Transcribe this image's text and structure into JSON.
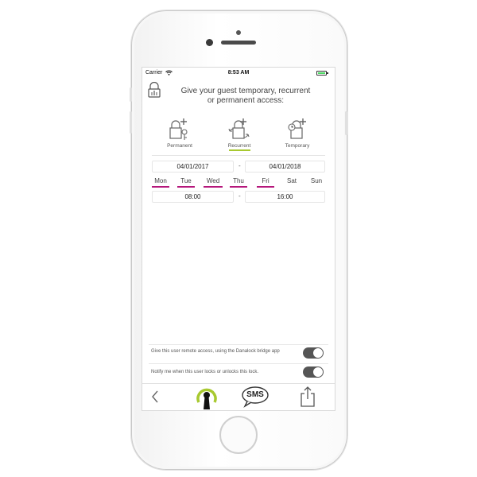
{
  "status_bar": {
    "carrier": "Carrier",
    "time": "8:53 AM"
  },
  "heading": {
    "line1": "Give your guest temporary, recurrent",
    "line2": "or permanent access:"
  },
  "access_types": [
    {
      "label": "Permanent",
      "selected": false
    },
    {
      "label": "Recurrent",
      "selected": true
    },
    {
      "label": "Temporary",
      "selected": false
    }
  ],
  "date_range": {
    "start": "04/01/2017",
    "separator": "-",
    "end": "04/01/2018"
  },
  "days": [
    {
      "label": "Mon",
      "active": true
    },
    {
      "label": "Tue",
      "active": true
    },
    {
      "label": "Wed",
      "active": true
    },
    {
      "label": "Thu",
      "active": true
    },
    {
      "label": "Fri",
      "active": true
    },
    {
      "label": "Sat",
      "active": false
    },
    {
      "label": "Sun",
      "active": false
    }
  ],
  "time_range": {
    "start": "08:00",
    "separator": "-",
    "end": "16:00"
  },
  "options": [
    {
      "text": "Give this user remote access, using the Danalock bridge app",
      "enabled": true
    },
    {
      "text": "Notify me when this user locks or unlocks this lock.",
      "enabled": true
    }
  ],
  "tabbar": {
    "back": "‹",
    "sms_label": "SMS"
  },
  "colors": {
    "accent_green": "#a8c930",
    "day_underline": "#b5177b",
    "toggle_on": "#555555",
    "battery": "#4cd964"
  }
}
